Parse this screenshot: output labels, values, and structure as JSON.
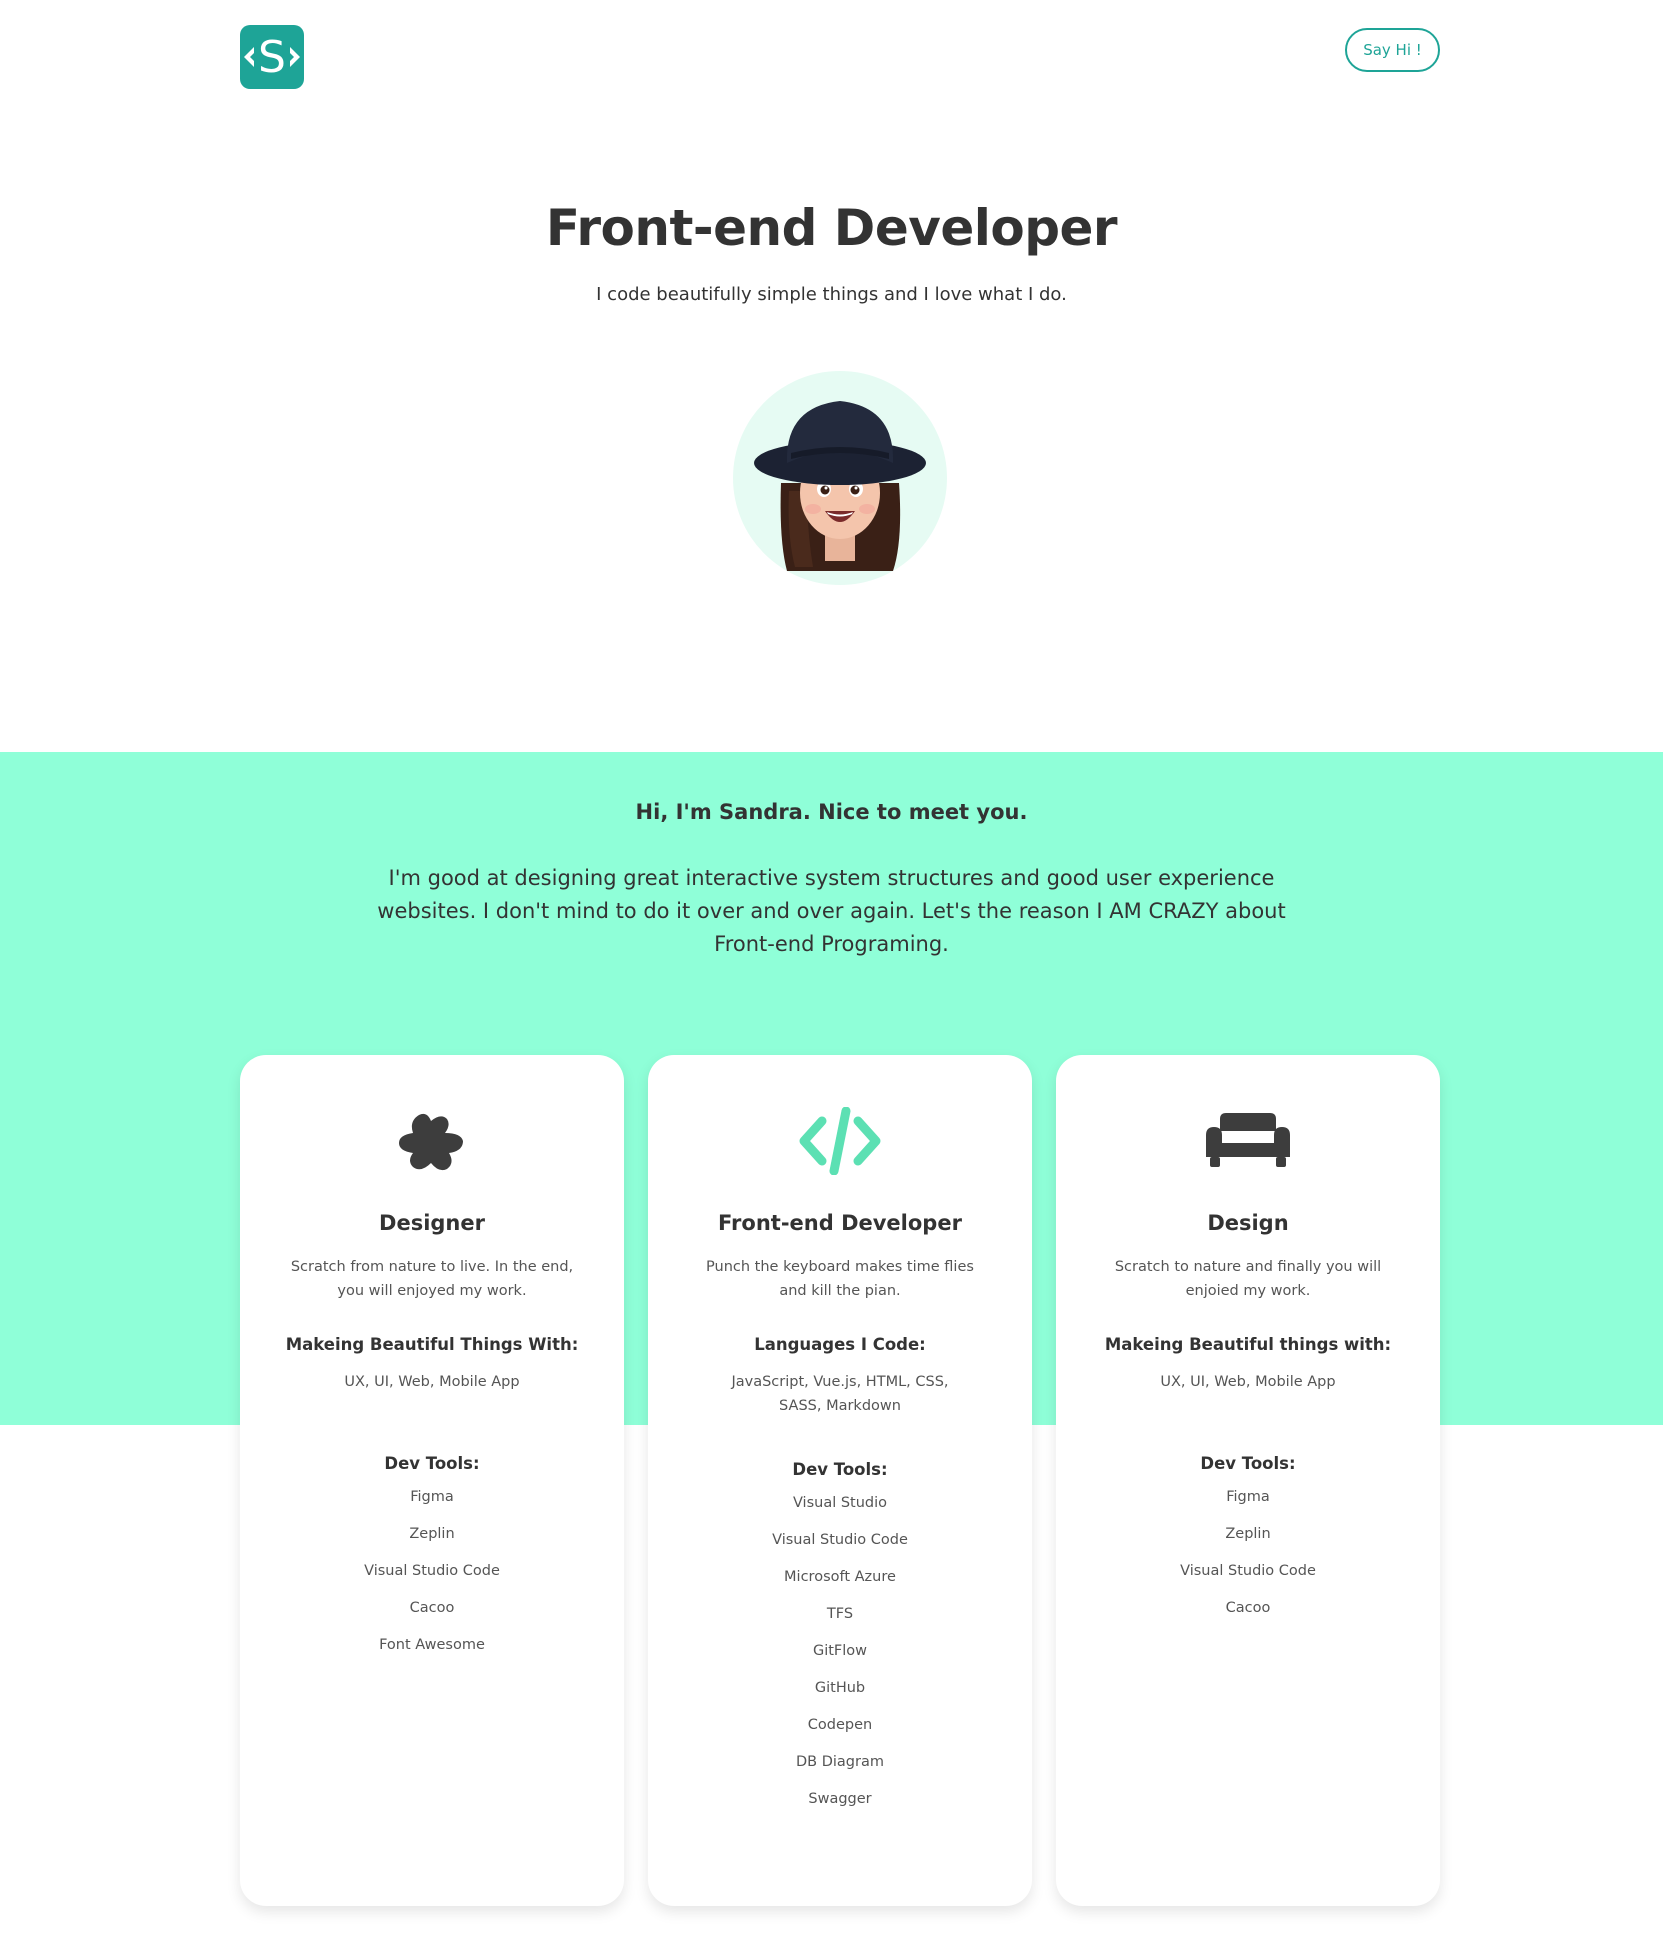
{
  "header": {
    "logo_letter": "S",
    "say_hi_label": "Say Hi !"
  },
  "hero": {
    "title": "Front-end Developer",
    "subtitle": "I code beautifully simple things and I love what I do."
  },
  "intro": {
    "title": "Hi, I'm Sandra. Nice to meet you.",
    "text": "I'm good at designing great interactive system structures and good user experience websites. I don't mind to do it over and over again. Let's the reason I AM CRAZY about Front-end Programing."
  },
  "cards": [
    {
      "icon": "splat-star-icon",
      "title": "Designer",
      "description": "Scratch from nature to live. In the end, you will enjoyed my work.",
      "heading": "Makeing Beautiful Things With:",
      "value": "UX, UI, Web, Mobile App",
      "tools_heading": "Dev Tools:",
      "tools": [
        "Figma",
        "Zeplin",
        "Visual Studio Code",
        "Cacoo",
        "Font Awesome"
      ]
    },
    {
      "icon": "code-icon",
      "title": "Front-end Developer",
      "description": "Punch the keyboard makes time flies and kill the pian.",
      "heading": "Languages I Code:",
      "value": "JavaScript, Vue.js, HTML, CSS, SASS, Markdown",
      "tools_heading": "Dev Tools:",
      "tools": [
        "Visual Studio",
        "Visual Studio Code",
        "Microsoft Azure",
        "TFS",
        "GitFlow",
        "GitHub",
        "Codepen",
        "DB Diagram",
        "Swagger"
      ]
    },
    {
      "icon": "couch-icon",
      "title": "Design",
      "description": "Scratch to nature and finally you will enjoied my work.",
      "heading": "Makeing Beautiful things with:",
      "value": "UX, UI, Web, Mobile App",
      "tools_heading": "Dev Tools:",
      "tools": [
        "Figma",
        "Zeplin",
        "Visual Studio Code",
        "Cacoo"
      ]
    }
  ],
  "colors": {
    "brand": "#1ea497",
    "section_bg": "#8fffd8",
    "code_icon": "#5ce0b3",
    "dark_icon": "#3d3d3d"
  }
}
